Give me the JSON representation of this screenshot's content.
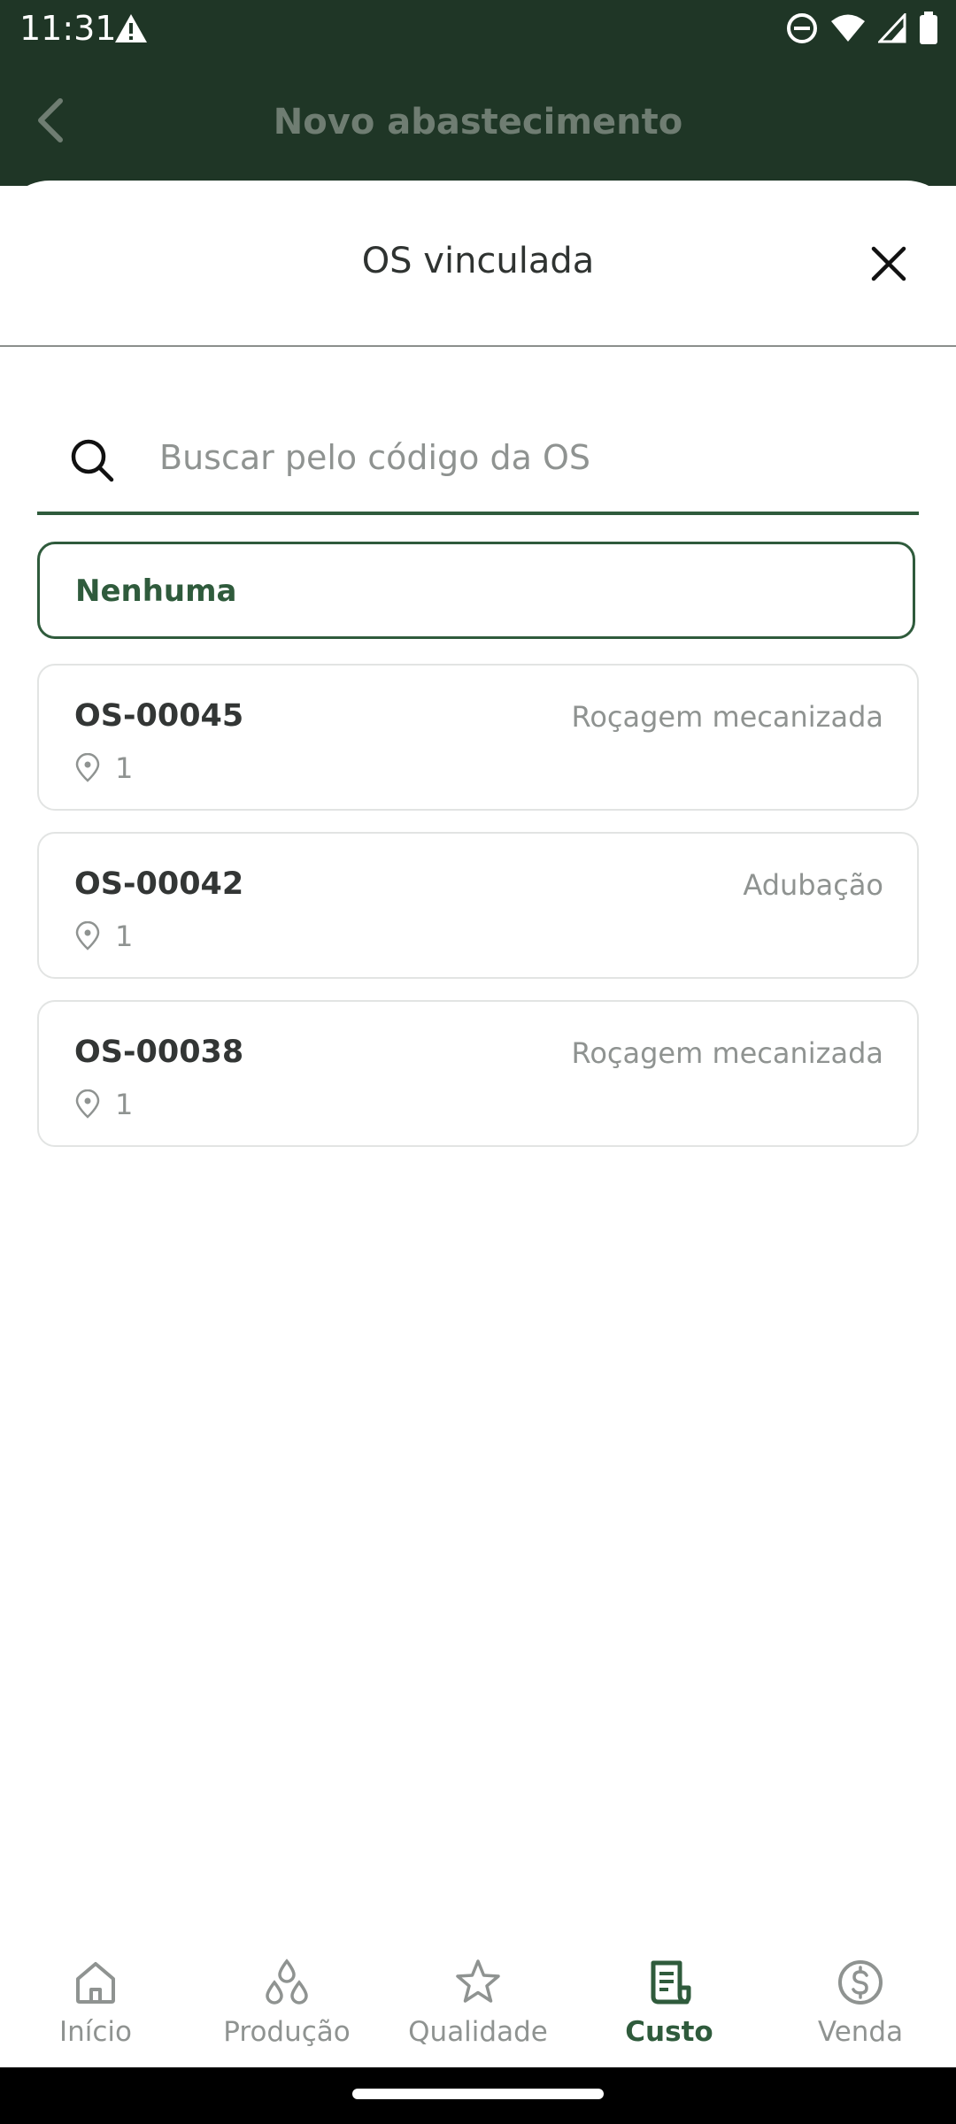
{
  "status_bar": {
    "time": "11:31"
  },
  "app_bar": {
    "title": "Novo abastecimento"
  },
  "sheet": {
    "title": "OS vinculada",
    "search_placeholder": "Buscar pelo código da OS",
    "none_option_label": "Nenhuma",
    "orders": [
      {
        "code": "OS-00045",
        "type": "Roçagem mecanizada",
        "location_count": "1"
      },
      {
        "code": "OS-00042",
        "type": "Adubação",
        "location_count": "1"
      },
      {
        "code": "OS-00038",
        "type": "Roçagem mecanizada",
        "location_count": "1"
      }
    ]
  },
  "bottom_nav": {
    "items": [
      {
        "label": "Início",
        "icon": "home-icon",
        "active": false
      },
      {
        "label": "Produção",
        "icon": "drops-icon",
        "active": false
      },
      {
        "label": "Qualidade",
        "icon": "star-icon",
        "active": false
      },
      {
        "label": "Custo",
        "icon": "receipt-icon",
        "active": true
      },
      {
        "label": "Venda",
        "icon": "dollar-circle-icon",
        "active": false
      }
    ]
  },
  "colors": {
    "primary_dark": "#1f3626",
    "primary": "#2f5b3c",
    "muted_text": "#8f9391"
  }
}
